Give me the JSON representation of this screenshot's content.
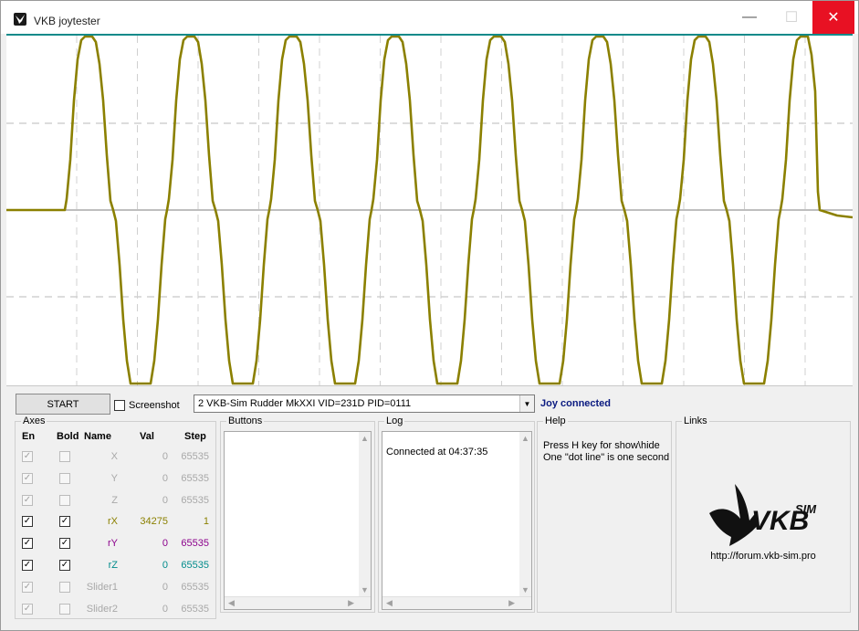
{
  "window": {
    "title": "VKB joytester",
    "icon": "vkb-bird-icon",
    "minimize_glyph": "—",
    "maximize_glyph": "☐",
    "close_glyph": "✕"
  },
  "plot": {
    "series_color": "#8b8000",
    "grid_color": "#b8b8b8",
    "top_line_color": "#0f8a8a"
  },
  "controls": {
    "start_label": "START",
    "screenshot_label": "Screenshot",
    "device_value": "2  VKB-Sim Rudder MkXXI  VID=231D PID=0111",
    "dropdown_arrow": "▼",
    "status_text": "Joy connected"
  },
  "axes": {
    "title": "Axes",
    "headers": {
      "en": "En",
      "bold": "Bold",
      "name": "Name",
      "val": "Val",
      "step": "Step"
    },
    "rows": [
      {
        "name": "X",
        "val": "0",
        "step": "65535",
        "enabled": true,
        "en_disabled": true,
        "bold": false,
        "color": "#a8a8a8"
      },
      {
        "name": "Y",
        "val": "0",
        "step": "65535",
        "enabled": true,
        "en_disabled": true,
        "bold": false,
        "color": "#a8a8a8"
      },
      {
        "name": "Z",
        "val": "0",
        "step": "65535",
        "enabled": true,
        "en_disabled": true,
        "bold": false,
        "color": "#a8a8a8"
      },
      {
        "name": "rX",
        "val": "34275",
        "step": "1",
        "enabled": true,
        "en_disabled": false,
        "bold": true,
        "color": "#8b8000"
      },
      {
        "name": "rY",
        "val": "0",
        "step": "65535",
        "enabled": true,
        "en_disabled": false,
        "bold": true,
        "color": "#8b008b"
      },
      {
        "name": "rZ",
        "val": "0",
        "step": "65535",
        "enabled": true,
        "en_disabled": false,
        "bold": true,
        "color": "#008b8b"
      },
      {
        "name": "Slider1",
        "val": "0",
        "step": "65535",
        "enabled": true,
        "en_disabled": true,
        "bold": false,
        "color": "#a8a8a8"
      },
      {
        "name": "Slider2",
        "val": "0",
        "step": "65535",
        "enabled": true,
        "en_disabled": true,
        "bold": false,
        "color": "#a8a8a8"
      }
    ]
  },
  "buttons_panel": {
    "title": "Buttons"
  },
  "log": {
    "title": "Log",
    "entries": [
      "Connected at 04:37:35"
    ]
  },
  "help": {
    "title": "Help",
    "line1": "Press H key for show\\hide",
    "line2": "One \"dot line\" is one second"
  },
  "links": {
    "title": "Links",
    "logo_text": "VKB",
    "logo_sup": "SIM",
    "url": "http://forum.vkb-sim.pro"
  }
}
